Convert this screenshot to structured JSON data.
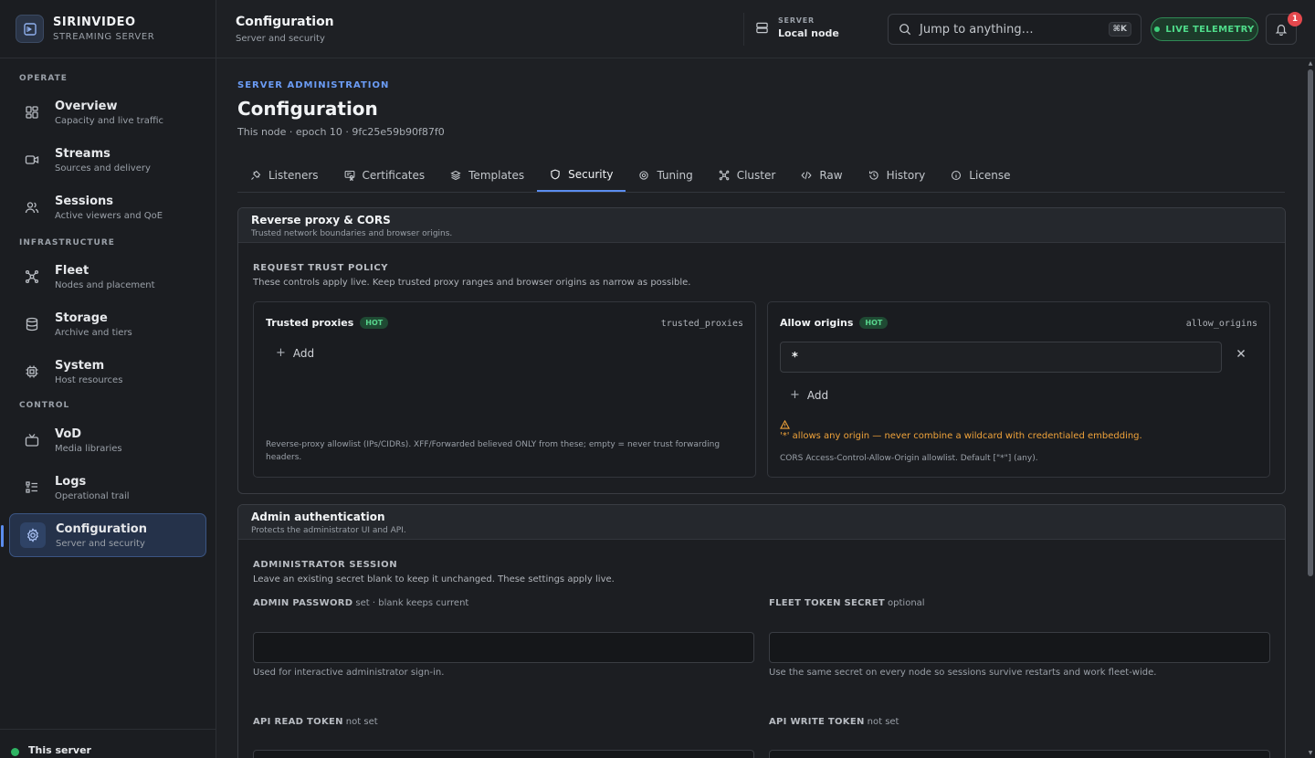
{
  "brand": {
    "name": "SIRINVIDEO",
    "subtitle": "STREAMING SERVER"
  },
  "sidebar": {
    "sections": [
      {
        "label": "OPERATE"
      },
      {
        "label": "INFRASTRUCTURE"
      },
      {
        "label": "CONTROL"
      }
    ],
    "items": [
      {
        "title": "Overview",
        "desc": "Capacity and live traffic"
      },
      {
        "title": "Streams",
        "desc": "Sources and delivery"
      },
      {
        "title": "Sessions",
        "desc": "Active viewers and QoE"
      },
      {
        "title": "Fleet",
        "desc": "Nodes and placement"
      },
      {
        "title": "Storage",
        "desc": "Archive and tiers"
      },
      {
        "title": "System",
        "desc": "Host resources"
      },
      {
        "title": "VoD",
        "desc": "Media libraries"
      },
      {
        "title": "Logs",
        "desc": "Operational trail"
      },
      {
        "title": "Configuration",
        "desc": "Server and security"
      }
    ],
    "footer": "This server"
  },
  "topbar": {
    "title": "Configuration",
    "subtitle": "Server and security",
    "server_label": "SERVER",
    "server_value": "Local node",
    "search_placeholder": "Jump to anything…",
    "search_shortcut": "⌘K",
    "live_label": "LIVE TELEMETRY",
    "notification_count": "1"
  },
  "page": {
    "eyebrow": "SERVER ADMINISTRATION",
    "title": "Configuration",
    "meta": "This node · epoch 10 · 9fc25e59b90f87f0"
  },
  "tabs": [
    {
      "label": "Listeners"
    },
    {
      "label": "Certificates"
    },
    {
      "label": "Templates"
    },
    {
      "label": "Security",
      "active": true
    },
    {
      "label": "Tuning"
    },
    {
      "label": "Cluster"
    },
    {
      "label": "Raw"
    },
    {
      "label": "History"
    },
    {
      "label": "License"
    }
  ],
  "proxy_card": {
    "title": "Reverse proxy & CORS",
    "subtitle": "Trusted network boundaries and browser origins.",
    "section_label": "REQUEST TRUST POLICY",
    "section_desc": "These controls apply live. Keep trusted proxy ranges and browser origins as narrow as possible.",
    "trusted_proxies": {
      "title": "Trusted proxies",
      "badge": "HOT",
      "key": "trusted_proxies",
      "add_label": "Add",
      "help": "Reverse-proxy allowlist (IPs/CIDRs). XFF/Forwarded believed ONLY from these; empty = never trust forwarding headers."
    },
    "allow_origins": {
      "title": "Allow origins",
      "badge": "HOT",
      "key": "allow_origins",
      "value": "*",
      "add_label": "Add",
      "warning": "'*' allows any origin — never combine a wildcard with credentialed embedding.",
      "help": "CORS Access-Control-Allow-Origin allowlist. Default [\"*\"] (any)."
    }
  },
  "auth_card": {
    "title": "Admin authentication",
    "subtitle": "Protects the administrator UI and API.",
    "section_label": "ADMINISTRATOR SESSION",
    "section_desc": "Leave an existing secret blank to keep it unchanged. These settings apply live.",
    "admin_password": {
      "label": "ADMIN PASSWORD",
      "hint": "set · blank keeps current",
      "value": "",
      "help": "Used for interactive administrator sign-in."
    },
    "fleet_token": {
      "label": "FLEET TOKEN SECRET",
      "hint": "optional",
      "value": "",
      "help": "Use the same secret on every node so sessions survive restarts and work fleet-wide."
    },
    "api_read": {
      "label": "API READ TOKEN",
      "hint": "not set"
    },
    "api_write": {
      "label": "API WRITE TOKEN",
      "hint": "not set"
    }
  },
  "colors": {
    "accent": "#5b8def",
    "live": "#4fdb8a",
    "warning": "#f0a33a",
    "badge": "#e5484d"
  }
}
